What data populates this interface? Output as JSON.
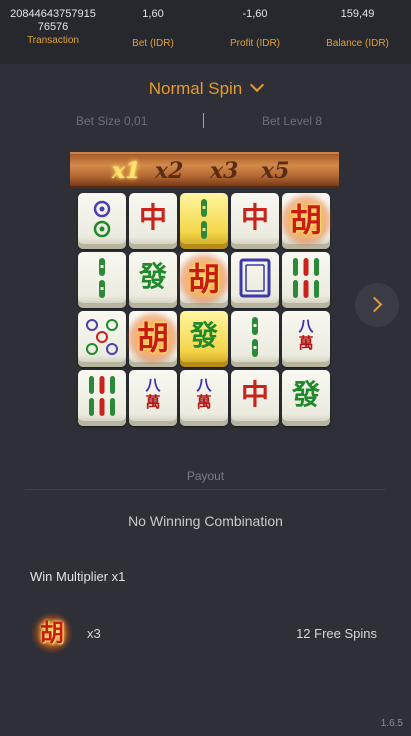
{
  "header": {
    "transaction": "20844643757915\n76576",
    "transaction_line1": "20844643757915",
    "transaction_line2": "76576",
    "transaction_label": "Transaction",
    "bet": "1,60",
    "bet_label": "Bet (IDR)",
    "profit": "-1,60",
    "profit_label": "Profit (IDR)",
    "balance": "159,49",
    "balance_label": "Balance (IDR)"
  },
  "spin_selector": {
    "label": "Normal Spin",
    "icon": "chevron-down-icon"
  },
  "bet_info": {
    "bet_size": "Bet Size 0,01",
    "bet_level": "Bet Level 8"
  },
  "multipliers": [
    {
      "label": "x1",
      "active": true
    },
    {
      "label": "x2",
      "active": false
    },
    {
      "label": "x3",
      "active": false
    },
    {
      "label": "x5",
      "active": false
    }
  ],
  "reels": [
    [
      "dots-2",
      "bamboo-2",
      "dots-5",
      "bamboo-6"
    ],
    [
      "zhong",
      "fa",
      "hu",
      "wan-8"
    ],
    [
      "bamboo-2-gold",
      "hu",
      "fa-gold",
      "wan-8"
    ],
    [
      "zhong",
      "white-dragon",
      "bamboo-2",
      "zhong"
    ],
    [
      "hu",
      "bamboo-6",
      "wan-8",
      "fa"
    ]
  ],
  "tile_text": {
    "zhong": "中",
    "fa": "發",
    "hu": "胡",
    "wan_top": "八",
    "wan_bottom": "萬"
  },
  "colors": {
    "accent": "#e59a2b",
    "background": "#2f3037",
    "header": "#27282e",
    "zhong_red": "#c8241c",
    "fa_green": "#1f8a2a"
  },
  "payout": {
    "title": "Payout",
    "result": "No Winning Combination"
  },
  "win_multiplier": "Win Multiplier x1",
  "scatter": {
    "icon": "hu-scatter-icon",
    "count": "x3",
    "free_spins": "12 Free Spins"
  },
  "version": "1.6.5"
}
